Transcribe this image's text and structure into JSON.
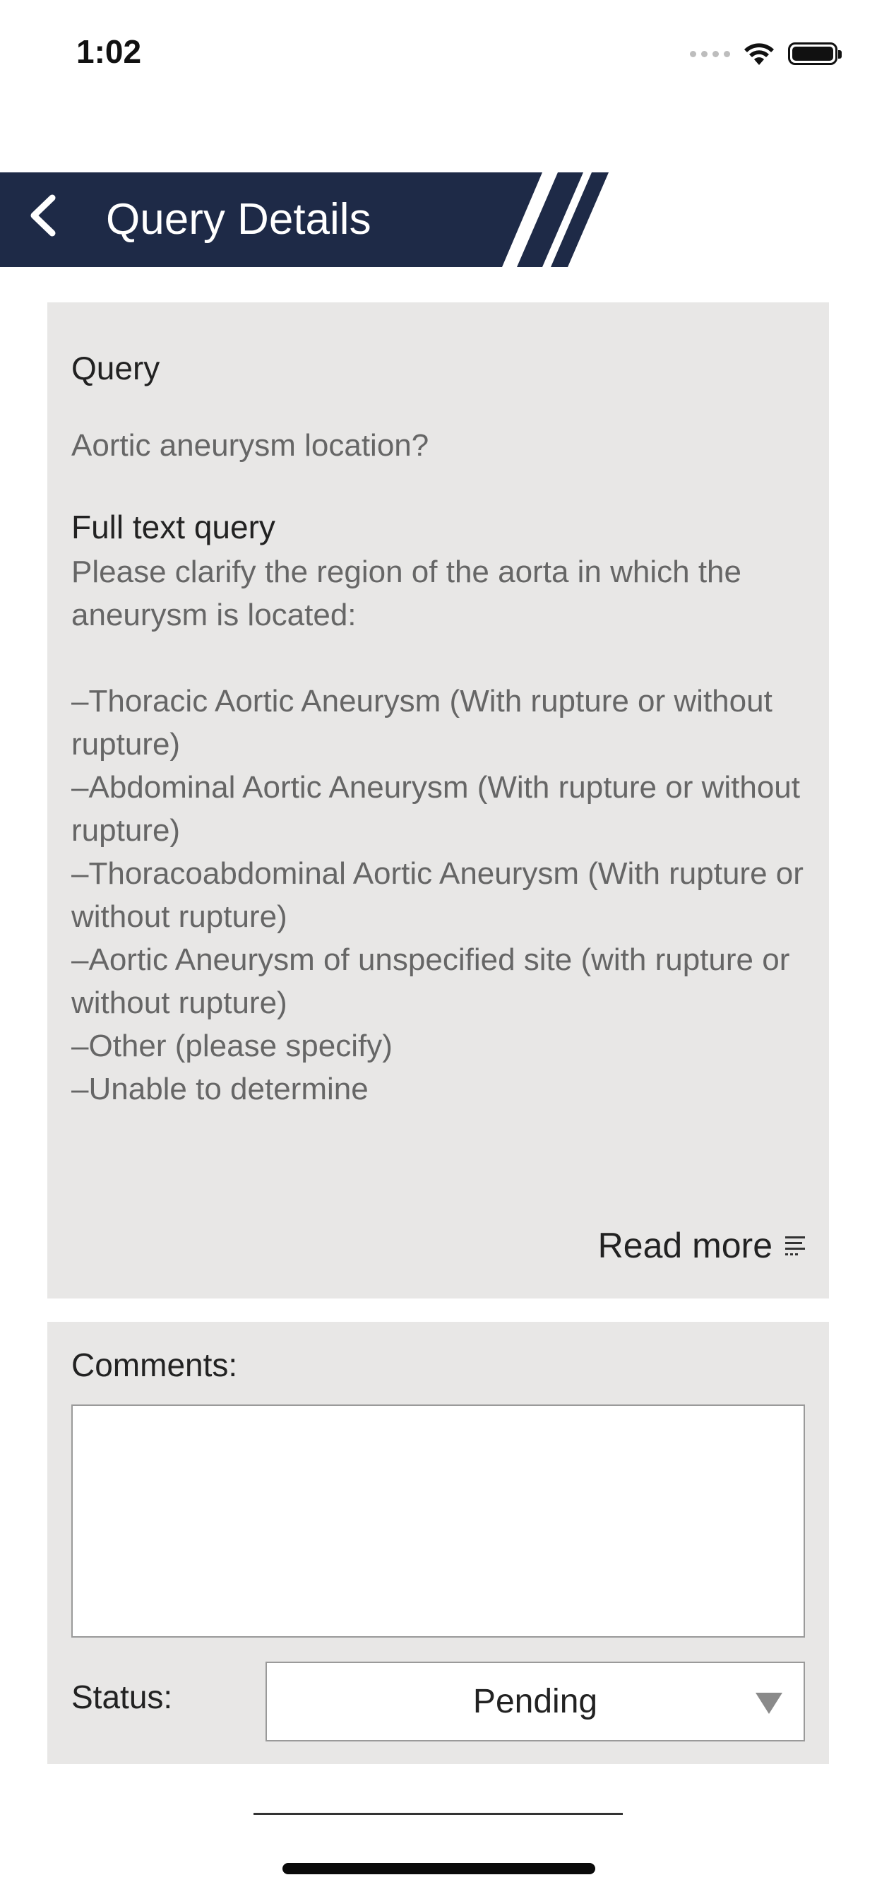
{
  "status_bar": {
    "time": "1:02",
    "icons": [
      "signal-dots-icon",
      "wifi-icon",
      "battery-icon"
    ]
  },
  "header": {
    "title": "Query Details",
    "back_icon": "chevron-left-icon",
    "banner_color": "#1e2a47"
  },
  "query_card": {
    "query_label": "Query",
    "query_value": "Aortic aneurysm location?",
    "full_text_label": "Full text query",
    "full_text_body": "Please clarify the region of the aorta in which the aneurysm is located:\n\n–Thoracic Aortic Aneurysm (With rupture or without rupture)\n–Abdominal Aortic Aneurysm (With rupture or without rupture)\n–Thoracoabdominal Aortic Aneurysm (With rupture or without rupture)\n–Aortic Aneurysm of unspecified site (with rupture or without rupture)\n–Other (please specify)\n–Unable to determine",
    "read_more_label": "Read more",
    "read_more_icon": "text-lines-icon"
  },
  "comments_card": {
    "comments_label": "Comments:",
    "comments_value": "",
    "status_label": "Status:",
    "status_value": "Pending",
    "dropdown_icon": "triangle-down-icon"
  },
  "colors": {
    "card_background": "#e8e7e6",
    "header_navy": "#1e2a47"
  }
}
